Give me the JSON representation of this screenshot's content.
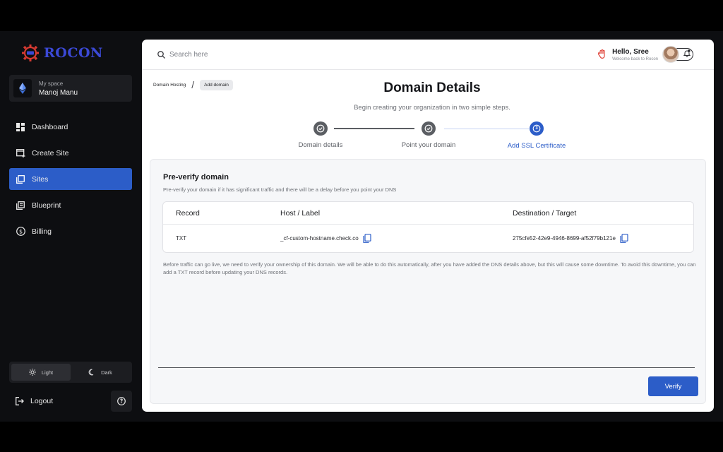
{
  "app": {
    "brand": "ROCON"
  },
  "workspace": {
    "caption": "My space",
    "name": "Manoj Manu"
  },
  "nav": {
    "items": [
      {
        "label": "Dashboard",
        "icon": "dashboard-icon",
        "active": false
      },
      {
        "label": "Create Site",
        "icon": "create-site-icon",
        "active": false
      },
      {
        "label": "Sites",
        "icon": "sites-icon",
        "active": true
      },
      {
        "label": "Blueprint",
        "icon": "blueprint-icon",
        "active": false
      },
      {
        "label": "Billing",
        "icon": "billing-icon",
        "active": false
      }
    ]
  },
  "theme": {
    "light_label": "Light",
    "dark_label": "Dark",
    "selected": "Light"
  },
  "footer": {
    "logout_label": "Logout"
  },
  "topbar": {
    "search_placeholder": "Search here",
    "greeting": "Hello, Sree",
    "welcome": "Welcome back to Rocon"
  },
  "breadcrumb": {
    "parent": "Domain Hosting",
    "separator": "/",
    "current": "Add domain"
  },
  "page": {
    "title": "Domain Details",
    "subtitle": "Begin creating your organization in two simple steps."
  },
  "steps": [
    {
      "label": "Domain details",
      "status": "done"
    },
    {
      "label": "Point your domain",
      "status": "done"
    },
    {
      "label": "Add SSL Certificate",
      "status": "current",
      "number": "3"
    }
  ],
  "preverify": {
    "title": "Pre-verify domain",
    "subtitle": "Pre-verify your domain if it has significant traffic and there will be a delay before you point your DNS",
    "columns": [
      "Record",
      "Host / Label",
      "Destination / Target"
    ],
    "rows": [
      {
        "record": "TXT",
        "host": "_cf-custom-hostname.check.co",
        "target": "275cfe52-42e9-4946-8699-af52f79b121e"
      }
    ],
    "note": "Before traffic can go live, we need to verify your ownership of this domain. We will be able to do this automatically, after you have added the DNS details above, but this will cause some downtime. To avoid this downtime, you can add a TXT record before updating your DNS records.",
    "verify_label": "Verify"
  },
  "colors": {
    "accent": "#2c5dc8",
    "sidebar_bg": "#0d0e11",
    "brand": "#3b49d6",
    "step_done": "#5b5e63"
  }
}
